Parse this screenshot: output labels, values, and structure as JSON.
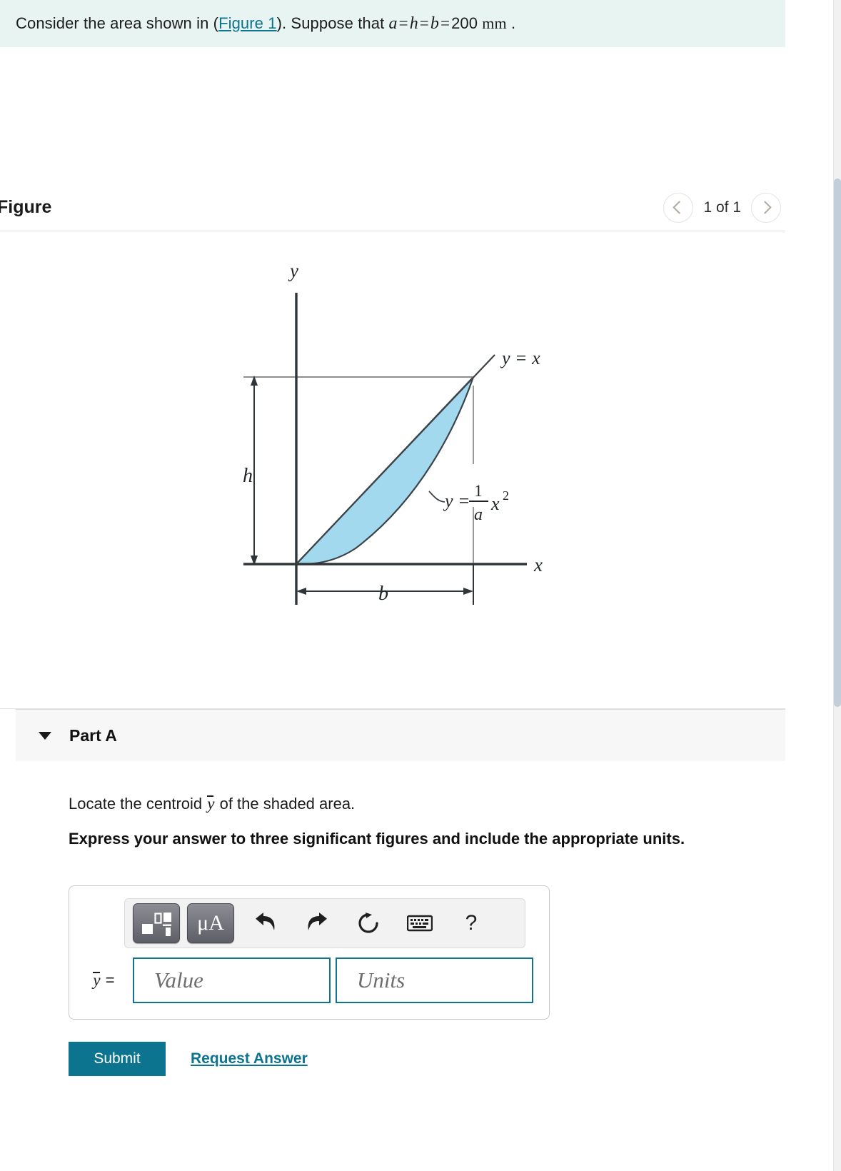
{
  "problem": {
    "text_before_link": "Consider the area shown in (",
    "link_label": "Figure 1",
    "text_after_link": "). Suppose that ",
    "var_a": "a",
    "eq1": "=",
    "var_h": "h",
    "eq2": "=",
    "var_b": "b",
    "eq3": "=",
    "value": "200",
    "units": "mm",
    "period": "."
  },
  "figure": {
    "title": "Figure",
    "page_count": "1 of 1",
    "prev_icon": "chevron-left-icon",
    "next_icon": "chevron-right-icon",
    "diagram": {
      "y_axis_label": "y",
      "x_axis_label": "x",
      "height_label": "h",
      "base_label": "b",
      "curve_line_label": "y = x",
      "curve_parabola_label_y": "y =",
      "curve_parabola_numerator": "1",
      "curve_parabola_denominator": "a",
      "curve_parabola_tail": "x",
      "curve_parabola_exponent": "2",
      "shade_color": "#a3d9ef",
      "outline_color": "#3d4449"
    }
  },
  "part": {
    "caret_icon": "caret-down-icon",
    "label": "Part A",
    "question": {
      "prefix": "Locate the centroid ",
      "symbol": "y",
      "suffix": " of the shaded area."
    },
    "instruction": "Express your answer to three significant figures and include the appropriate units."
  },
  "answer": {
    "toolbar": {
      "template_button": "template-icon",
      "units_button_label": "μA",
      "undo_icon": "undo-arrow-icon",
      "redo_icon": "redo-arrow-icon",
      "reset_icon": "reset-circle-icon",
      "keyboard_icon": "keyboard-icon",
      "help_label": "?"
    },
    "label": "=",
    "label_symbol": "y",
    "value_placeholder": "Value",
    "units_placeholder": "Units"
  },
  "actions": {
    "submit_label": "Submit",
    "request_answer_label": "Request Answer"
  },
  "colors": {
    "banner_bg": "#e7f4f2",
    "accent": "#0d7490",
    "input_border": "#0e7490",
    "shade": "#a3d9ef"
  }
}
